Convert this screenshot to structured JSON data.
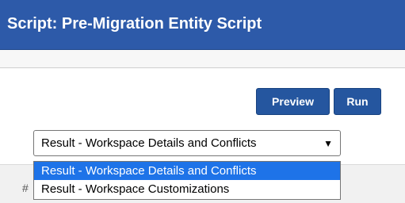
{
  "header": {
    "title": "Script: Pre-Migration Entity Script"
  },
  "toolbar": {
    "preview_label": "Preview",
    "run_label": "Run"
  },
  "result_select": {
    "selected_value": "Result - Workspace Details and Conflicts",
    "caret": "▼",
    "options": [
      {
        "label": "Result - Workspace Details and Conflicts",
        "selected": true
      },
      {
        "label": "Result - Workspace Customizations",
        "selected": false
      }
    ]
  },
  "table": {
    "hash_header": "#"
  },
  "colors": {
    "header_bg": "#2d5aa9",
    "button_bg": "#25569f",
    "selected_option_bg": "#1e73e8"
  }
}
